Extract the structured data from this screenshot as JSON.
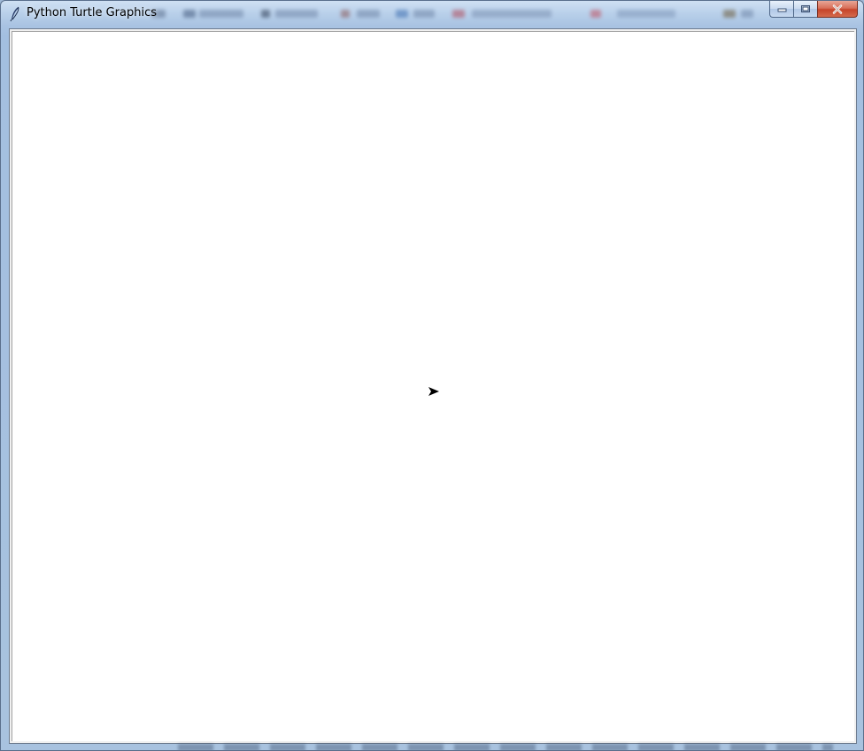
{
  "window": {
    "title": "Python Turtle Graphics"
  },
  "icons": {
    "app": "feather-icon",
    "turtle": "arrow-turtle-icon",
    "minimize": "minimize-icon",
    "maximize": "restore-icon",
    "close": "close-icon"
  },
  "colors": {
    "canvas_background": "#ffffff",
    "turtle": "#000000",
    "titlebar": "#b9d0ea",
    "close_button": "#c6442a"
  },
  "turtle": {
    "shape": "arrow",
    "heading": "east"
  }
}
